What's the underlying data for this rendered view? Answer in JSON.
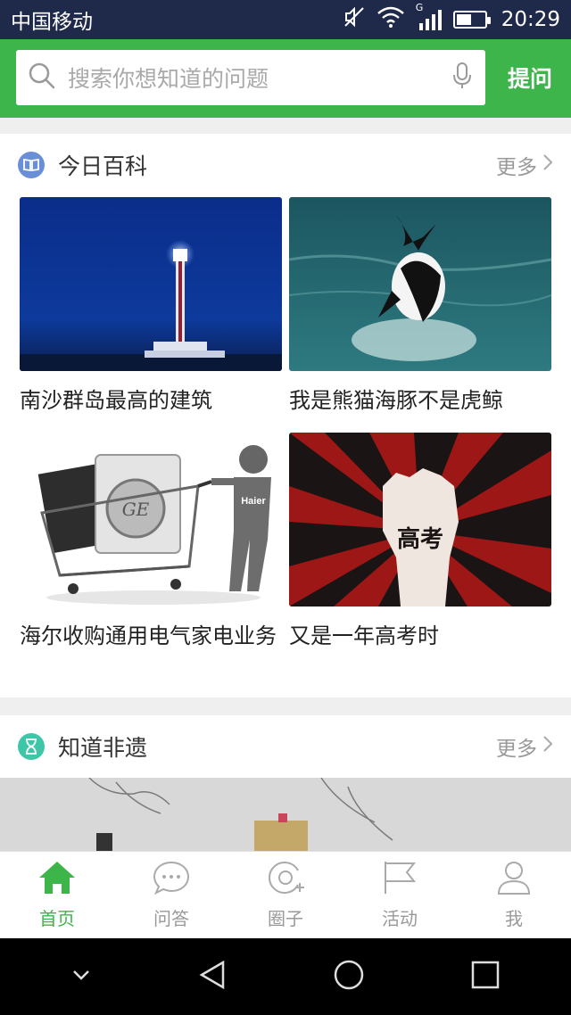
{
  "status_bar": {
    "carrier": "中国移动",
    "signal_type": "G",
    "time": "20:29",
    "battery_level": 0.55,
    "icons": [
      "mute-icon",
      "wifi-icon",
      "cellular-signal-icon",
      "battery-icon"
    ]
  },
  "search": {
    "placeholder": "搜索你想知道的问题",
    "ask_label": "提问"
  },
  "today_baike": {
    "title": "今日百科",
    "more_label": "更多",
    "items": [
      {
        "title": "南沙群岛最高的建筑"
      },
      {
        "title": "我是熊猫海豚不是虎鲸"
      },
      {
        "title": "海尔收购通用电气家电业务"
      },
      {
        "title": "又是一年高考时"
      }
    ],
    "image_text": {
      "haier_logo": "Haier",
      "gaokao": "高考"
    }
  },
  "heritage": {
    "title": "知道非遗",
    "more_label": "更多"
  },
  "bottom_nav": {
    "items": [
      {
        "label": "首页",
        "icon": "home-icon",
        "active": true
      },
      {
        "label": "问答",
        "icon": "chat-bubble-icon",
        "active": false
      },
      {
        "label": "圈子",
        "icon": "circle-add-icon",
        "active": false
      },
      {
        "label": "活动",
        "icon": "flag-icon",
        "active": false
      },
      {
        "label": "我",
        "icon": "person-icon",
        "active": false
      }
    ]
  },
  "colors": {
    "brand_green": "#3db54a",
    "status_bar_bg": "#1f2a4a",
    "baike_icon_blue": "#6b8fd6",
    "heritage_icon_teal": "#3ec6a8"
  }
}
